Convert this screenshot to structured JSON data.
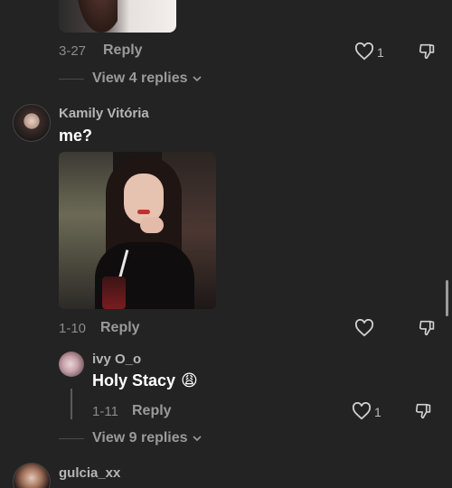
{
  "comments": [
    {
      "date": "3-27",
      "reply_label": "Reply",
      "likes": "1",
      "view_replies": "View 4 replies"
    },
    {
      "username": "Kamily Vitória",
      "text": "me?",
      "date": "1-10",
      "reply_label": "Reply",
      "likes": "",
      "replies": [
        {
          "username": "ivy O_o",
          "text": "Holy Stacy",
          "emoji": "😩",
          "date": "1-11",
          "reply_label": "Reply",
          "likes": "1"
        }
      ],
      "view_replies": "View 9 replies"
    },
    {
      "username": "gulcia_xx"
    }
  ],
  "icons": {
    "like": "heart-outline-icon",
    "dislike": "thumbs-down-outline-icon",
    "expand": "chevron-down-icon"
  },
  "colors": {
    "background": "#232323",
    "muted_text": "#8a8a8a",
    "username": "#b5b5b5"
  }
}
